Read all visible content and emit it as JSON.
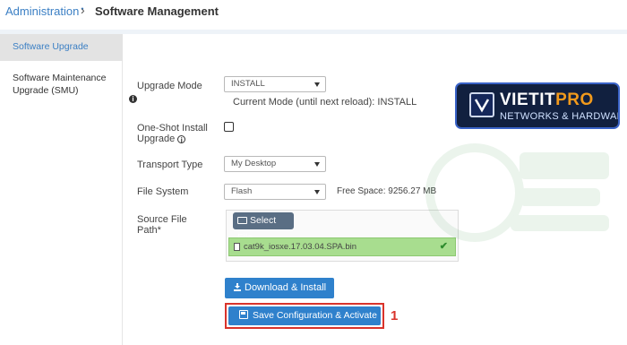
{
  "breadcrumb": {
    "parent": "Administration",
    "parent_marker": "•",
    "separator": "›",
    "current": "Software Management"
  },
  "sidebar": {
    "items": [
      {
        "label": "Software Upgrade",
        "active": true
      },
      {
        "label": "Software Maintenance Upgrade (SMU)",
        "active": false
      }
    ]
  },
  "form": {
    "upgrade_mode": {
      "label": "Upgrade Mode",
      "value": "INSTALL",
      "current_mode_text": "Current Mode (until next reload): INSTALL"
    },
    "one_shot": {
      "label": "One-Shot Install Upgrade",
      "checked": false
    },
    "transport_type": {
      "label": "Transport Type",
      "value": "My Desktop"
    },
    "file_system": {
      "label": "File System",
      "value": "Flash",
      "free_space": "Free Space: 9256.27 MB"
    },
    "source_file_path": {
      "label": "Source File Path*",
      "select_button": "Select File",
      "selected_file": "cat9k_iosxe.17.03.04.SPA.bin"
    }
  },
  "actions": {
    "download_install": "Download & Install",
    "save_activate": "Save Configuration & Activate",
    "step_number": "1"
  },
  "logo": {
    "brand_main": "VIETIT",
    "brand_accent": "PRO",
    "tagline": "NETWORKS & HARDWARE"
  },
  "colors": {
    "link_blue": "#3b7fc4",
    "button_blue": "#2f81cc",
    "file_row_green": "#a8dd8f",
    "highlight_red": "#d9332b",
    "logo_bg": "#11203f",
    "logo_accent": "#f29a1c"
  }
}
